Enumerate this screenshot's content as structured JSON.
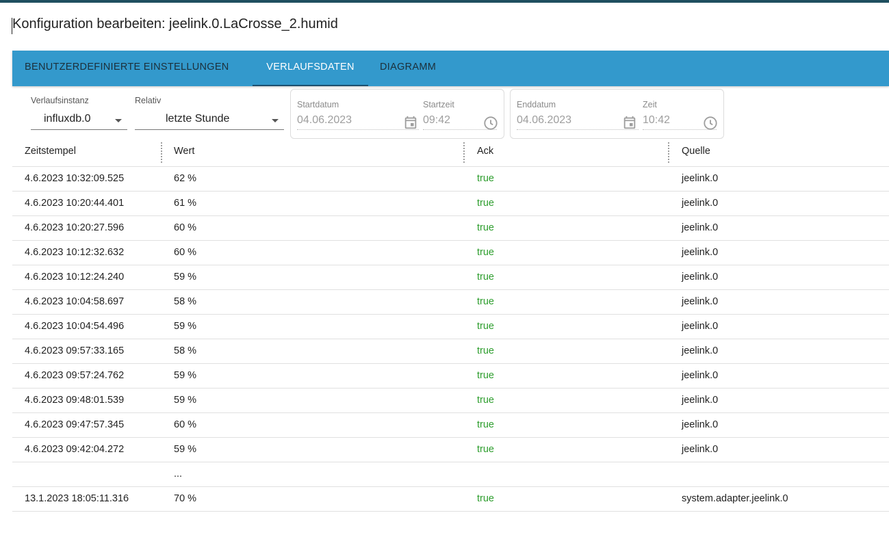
{
  "dialog": {
    "title": "Konfiguration bearbeiten: jeelink.0.LaCrosse_2.humid"
  },
  "tabs": [
    {
      "label": "BENUTZERDEFINIERTE EINSTELLUNGEN"
    },
    {
      "label": "VERLAUFSDATEN"
    },
    {
      "label": "DIAGRAMM"
    }
  ],
  "active_tab": "VERLAUFSDATEN",
  "filters": {
    "instance": {
      "label": "Verlaufsinstanz",
      "value": "influxdb.0"
    },
    "relative": {
      "label": "Relativ",
      "value": "letzte Stunde"
    },
    "start": {
      "date_label": "Startdatum",
      "date": "04.06.2023",
      "time_label": "Startzeit",
      "time": "09:42"
    },
    "end": {
      "date_label": "Enddatum",
      "date": "04.06.2023",
      "time_label": "Zeit",
      "time": "10:42"
    }
  },
  "table": {
    "columns": [
      "Zeitstempel",
      "Wert",
      "Ack",
      "Quelle"
    ],
    "rows": [
      {
        "ts": "4.6.2023 10:32:09.525",
        "val": "62 %",
        "ack": "true",
        "src": "jeelink.0"
      },
      {
        "ts": "4.6.2023 10:20:44.401",
        "val": "61 %",
        "ack": "true",
        "src": "jeelink.0"
      },
      {
        "ts": "4.6.2023 10:20:27.596",
        "val": "60 %",
        "ack": "true",
        "src": "jeelink.0"
      },
      {
        "ts": "4.6.2023 10:12:32.632",
        "val": "60 %",
        "ack": "true",
        "src": "jeelink.0"
      },
      {
        "ts": "4.6.2023 10:12:24.240",
        "val": "59 %",
        "ack": "true",
        "src": "jeelink.0"
      },
      {
        "ts": "4.6.2023 10:04:58.697",
        "val": "58 %",
        "ack": "true",
        "src": "jeelink.0"
      },
      {
        "ts": "4.6.2023 10:04:54.496",
        "val": "59 %",
        "ack": "true",
        "src": "jeelink.0"
      },
      {
        "ts": "4.6.2023 09:57:33.165",
        "val": "58 %",
        "ack": "true",
        "src": "jeelink.0"
      },
      {
        "ts": "4.6.2023 09:57:24.762",
        "val": "59 %",
        "ack": "true",
        "src": "jeelink.0"
      },
      {
        "ts": "4.6.2023 09:48:01.539",
        "val": "59 %",
        "ack": "true",
        "src": "jeelink.0"
      },
      {
        "ts": "4.6.2023 09:47:57.345",
        "val": "60 %",
        "ack": "true",
        "src": "jeelink.0"
      },
      {
        "ts": "4.6.2023 09:42:04.272",
        "val": "59 %",
        "ack": "true",
        "src": "jeelink.0"
      },
      {
        "ts": "",
        "val": "...",
        "ack": "",
        "src": ""
      },
      {
        "ts": "13.1.2023 18:05:11.316",
        "val": "70 %",
        "ack": "true",
        "src": "system.adapter.jeelink.0"
      }
    ]
  },
  "colors": {
    "tab_bar": "#3399cc",
    "ack_true": "#2e9e2e",
    "tab_active": "#ffffff",
    "tab_inactive": "#1c2f3a"
  },
  "icons": {
    "date_picker": "calendar-icon",
    "time_picker": "clock-icon",
    "dropdown": "caret-down-icon"
  }
}
